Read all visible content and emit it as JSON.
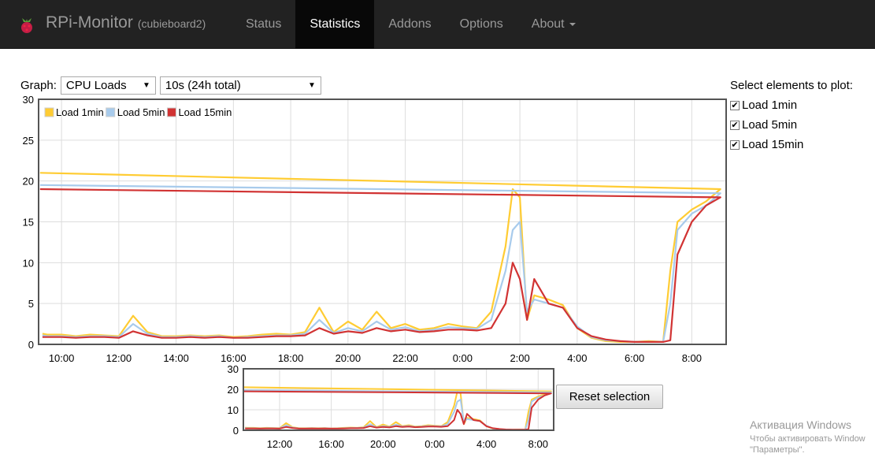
{
  "navbar": {
    "title": "RPi-Monitor",
    "subtitle": "(cubieboard2)",
    "items": [
      {
        "label": "Status"
      },
      {
        "label": "Statistics",
        "active": true
      },
      {
        "label": "Addons"
      },
      {
        "label": "Options"
      },
      {
        "label": "About",
        "dropdown": true
      }
    ]
  },
  "controls": {
    "graph_label": "Graph:",
    "graph_value": "CPU Loads",
    "period_value": "10s (24h total)"
  },
  "select_panel": {
    "title": "Select elements to plot:",
    "items": [
      {
        "label": "Load 1min",
        "checked": true
      },
      {
        "label": "Load 5min",
        "checked": true
      },
      {
        "label": "Load 15min",
        "checked": true
      }
    ]
  },
  "reset_label": "Reset selection",
  "watermark": {
    "line1": "Активация Windows",
    "line2": "Чтобы активировать Window",
    "line3": "\"Параметры\"."
  },
  "chart_data": {
    "type": "line",
    "legend_position": "top-left",
    "grid": true,
    "ylim": [
      0,
      30
    ],
    "yticks": [
      0,
      5,
      10,
      15,
      20,
      25,
      30
    ],
    "xticks": [
      "10:00",
      "12:00",
      "14:00",
      "16:00",
      "18:00",
      "20:00",
      "22:00",
      "0:00",
      "2:00",
      "4:00",
      "6:00",
      "8:00"
    ],
    "overview_yticks": [
      0,
      10,
      20,
      30
    ],
    "overview_xticks": [
      "12:00",
      "16:00",
      "20:00",
      "0:00",
      "4:00",
      "8:00"
    ],
    "x": [
      "09:20",
      "09:30",
      "10:00",
      "10:30",
      "11:00",
      "11:30",
      "12:00",
      "12:30",
      "13:00",
      "13:30",
      "14:00",
      "14:30",
      "15:00",
      "15:30",
      "16:00",
      "16:30",
      "17:00",
      "17:30",
      "18:00",
      "18:30",
      "19:00",
      "19:30",
      "20:00",
      "20:30",
      "21:00",
      "21:30",
      "22:00",
      "22:30",
      "23:00",
      "23:30",
      "0:00",
      "0:30",
      "1:00",
      "1:30",
      "1:45",
      "2:00",
      "2:15",
      "2:30",
      "3:00",
      "3:30",
      "4:00",
      "4:30",
      "5:00",
      "5:30",
      "6:00",
      "6:30",
      "7:00",
      "7:15",
      "7:30",
      "8:00",
      "8:30",
      "9:00",
      "9:15"
    ],
    "series": [
      {
        "name": "Load 1min",
        "color": "#ffcc33",
        "values": [
          1.3,
          1.2,
          1.2,
          1.0,
          1.2,
          1.1,
          1.0,
          3.5,
          1.5,
          1.0,
          1.0,
          1.1,
          1.0,
          1.1,
          0.9,
          1.0,
          1.2,
          1.3,
          1.2,
          1.5,
          4.5,
          1.5,
          2.8,
          1.8,
          4.0,
          2.0,
          2.5,
          1.8,
          2.0,
          2.5,
          2.2,
          2.0,
          4.0,
          12,
          19,
          18,
          3,
          6,
          5.5,
          4.8,
          2.0,
          0.8,
          0.4,
          0.3,
          0.3,
          0.4,
          0.3,
          9,
          15,
          16.5,
          17.5,
          19,
          21
        ]
      },
      {
        "name": "Load 5min",
        "color": "#a8cbec",
        "values": [
          1.1,
          1.0,
          1.0,
          0.9,
          1.0,
          1.0,
          0.9,
          2.5,
          1.3,
          0.9,
          0.9,
          1.0,
          0.9,
          1.0,
          0.8,
          0.9,
          1.0,
          1.1,
          1.1,
          1.3,
          3.0,
          1.4,
          2.0,
          1.6,
          2.8,
          1.8,
          2.1,
          1.6,
          1.8,
          2.1,
          2.0,
          1.9,
          3.0,
          9,
          14,
          15,
          4,
          5.5,
          5,
          4.5,
          2.2,
          0.9,
          0.5,
          0.4,
          0.3,
          0.3,
          0.3,
          5,
          14,
          16,
          17,
          18.5,
          19.5
        ]
      },
      {
        "name": "Load 15min",
        "color": "#d13333",
        "values": [
          0.9,
          0.9,
          0.9,
          0.8,
          0.9,
          0.9,
          0.8,
          1.6,
          1.1,
          0.8,
          0.8,
          0.9,
          0.8,
          0.9,
          0.8,
          0.8,
          0.9,
          1.0,
          1.0,
          1.1,
          2.0,
          1.3,
          1.6,
          1.4,
          2.0,
          1.6,
          1.8,
          1.5,
          1.6,
          1.8,
          1.8,
          1.7,
          2.0,
          5,
          10,
          8,
          3,
          8,
          5,
          4.5,
          2.0,
          1.0,
          0.6,
          0.4,
          0.3,
          0.3,
          0.3,
          0.5,
          11,
          15,
          17,
          18,
          19
        ]
      }
    ]
  }
}
